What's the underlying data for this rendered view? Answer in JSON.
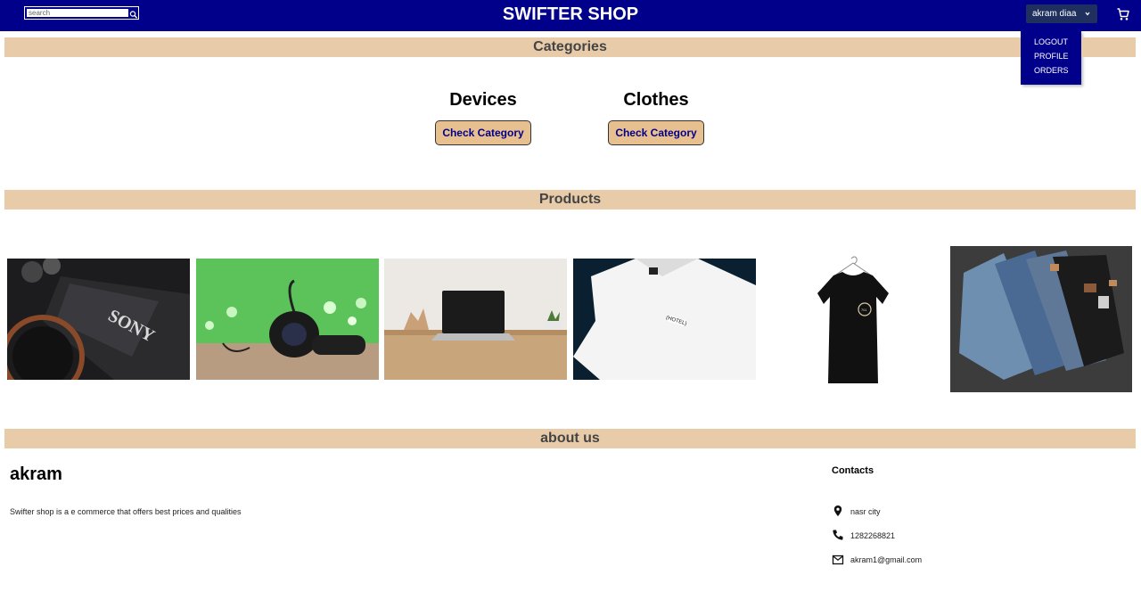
{
  "header": {
    "search_placeholder": "search",
    "brand": "SWIFTER SHOP",
    "user_name": "akram diaa",
    "background_color": "#00008b"
  },
  "user_menu": {
    "items": [
      "LOGOUT",
      "PROFILE",
      "ORDERS"
    ]
  },
  "sections": {
    "categories": "Categories",
    "products": "Products",
    "about": "about us"
  },
  "categories": [
    {
      "name": "Devices",
      "button": "Check Category"
    },
    {
      "name": "Clothes",
      "button": "Check Category"
    }
  ],
  "products": [
    {
      "icon": "sony-camera-image"
    },
    {
      "icon": "headphones-image"
    },
    {
      "icon": "laptop-image"
    },
    {
      "icon": "white-tshirt-image"
    },
    {
      "icon": "black-tshirt-image"
    },
    {
      "icon": "jeans-image"
    }
  ],
  "about": {
    "name": "akram",
    "description": "Swifter shop is a e commerce that offers best prices and qualities",
    "contacts_title": "Contacts",
    "contacts": [
      {
        "icon": "location-pin-icon",
        "text": "nasr city"
      },
      {
        "icon": "phone-icon",
        "text": "1282268821"
      },
      {
        "icon": "mail-icon",
        "text": "akram1@gmail.com"
      }
    ]
  },
  "colors": {
    "header": "#00008b",
    "section_bar": "#e8ccaa",
    "category_button": "#e8bf8f"
  }
}
